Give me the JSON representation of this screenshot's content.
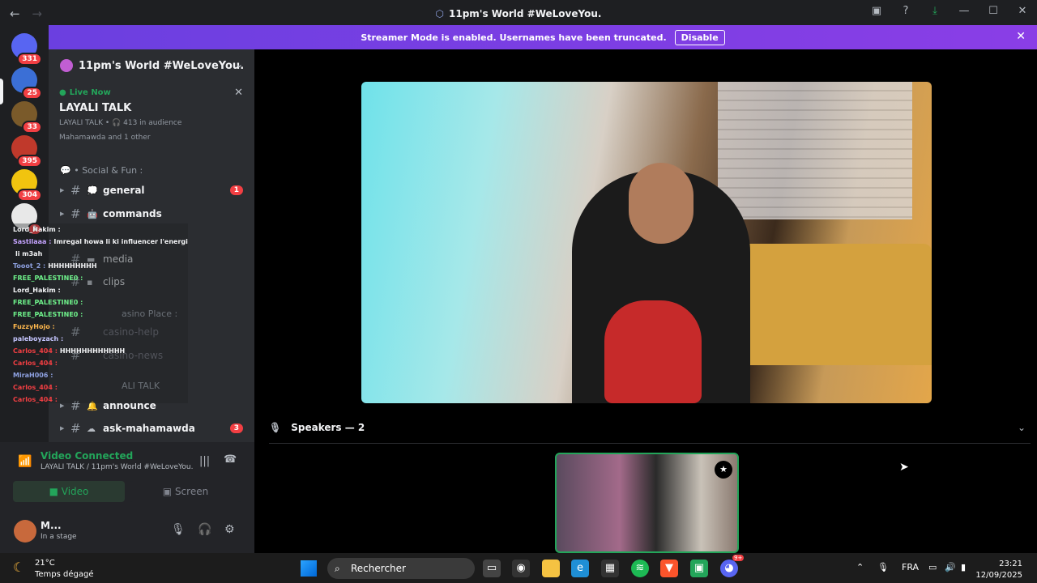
{
  "window": {
    "title": "11pm's World #WeLoveYou.",
    "back_icon": "←",
    "forward_icon": "→"
  },
  "banner": {
    "text": "Streamer Mode is enabled. Usernames have been truncated.",
    "button": "Disable"
  },
  "servers": [
    {
      "badge": "331",
      "color": "#5865f2"
    },
    {
      "badge": "25",
      "color": "#3b6fd6"
    },
    {
      "badge": "33",
      "color": "#7a5a2a"
    },
    {
      "badge": "395",
      "color": "#c0392b"
    },
    {
      "badge": "304",
      "color": "#f1c40f"
    },
    {
      "badge": "1",
      "color": "#e8e8e8"
    }
  ],
  "guild": {
    "name": "11pm's World #WeLoveYou."
  },
  "live": {
    "status": "Live Now",
    "title": "LAYALI TALK",
    "meta": "LAYALI TALK • 🎧 413 in audience",
    "users": "Mahamawda and 1 other"
  },
  "categories": {
    "social": "• Social & Fun :",
    "casino": "asino Place :",
    "layali": "ALI TALK"
  },
  "channels": {
    "general": {
      "name": "general",
      "count": "1"
    },
    "commands": {
      "name": "commands"
    },
    "media": {
      "name": "media"
    },
    "clips": {
      "name": "clips"
    },
    "casino_help": {
      "name": "casino-help"
    },
    "casino_news": {
      "name": "casino-news"
    },
    "announce": {
      "name": "announce"
    },
    "ask": {
      "name": "ask-mahamawda",
      "count": "3"
    }
  },
  "chat_overlay": [
    {
      "user": "Lord_Hakim :",
      "color": "#f2f3f5",
      "msg": ""
    },
    {
      "user": "Sastilaaa :",
      "color": "#c5a3ff",
      "msg": "Imregal howa li ki influencer l'energie dyal"
    },
    {
      "user": "",
      "color": "#f2f3f5",
      "msg": "li m3ah"
    },
    {
      "user": "Tooot_2 :",
      "color": "#8ea1e1",
      "msg": "HHHHHHHHH"
    },
    {
      "user": "FREE_PALESTINE0 :",
      "color": "#6ef08a",
      "msg": ""
    },
    {
      "user": "Lord_Hakim :",
      "color": "#f2f3f5",
      "msg": ""
    },
    {
      "user": "FREE_PALESTINE0 :",
      "color": "#6ef08a",
      "msg": ""
    },
    {
      "user": "FREE_PALESTINE0 :",
      "color": "#6ef08a",
      "msg": ""
    },
    {
      "user": "FuzzyHojo :",
      "color": "#ffb84d",
      "msg": ""
    },
    {
      "user": "paleboyzach :",
      "color": "#c5c5ff",
      "msg": ""
    },
    {
      "user": "Carlos_404 :",
      "color": "#f23f43",
      "msg": "HHHHHHHHHHHH"
    },
    {
      "user": "Carlos_404 :",
      "color": "#f23f43",
      "msg": ""
    },
    {
      "user": "MiraH006 :",
      "color": "#8ea1e1",
      "msg": ""
    },
    {
      "user": "Carlos_404 :",
      "color": "#f23f43",
      "msg": ""
    },
    {
      "user": "Carlos_404 :",
      "color": "#f23f43",
      "msg": ""
    }
  ],
  "voice": {
    "status": "Video Connected",
    "sub": "LAYALI TALK / 11pm's World #WeLoveYou.",
    "video": "Video",
    "screen": "Screen"
  },
  "user": {
    "name": "M...",
    "status": "In a stage"
  },
  "stage": {
    "speakers": "Speakers — 2"
  },
  "taskbar": {
    "temp": "21°C",
    "condition": "Temps dégagé",
    "search": "Rechercher",
    "lang": "FRA",
    "time": "23:21",
    "date": "12/09/2025",
    "discord_badge": "9+"
  }
}
